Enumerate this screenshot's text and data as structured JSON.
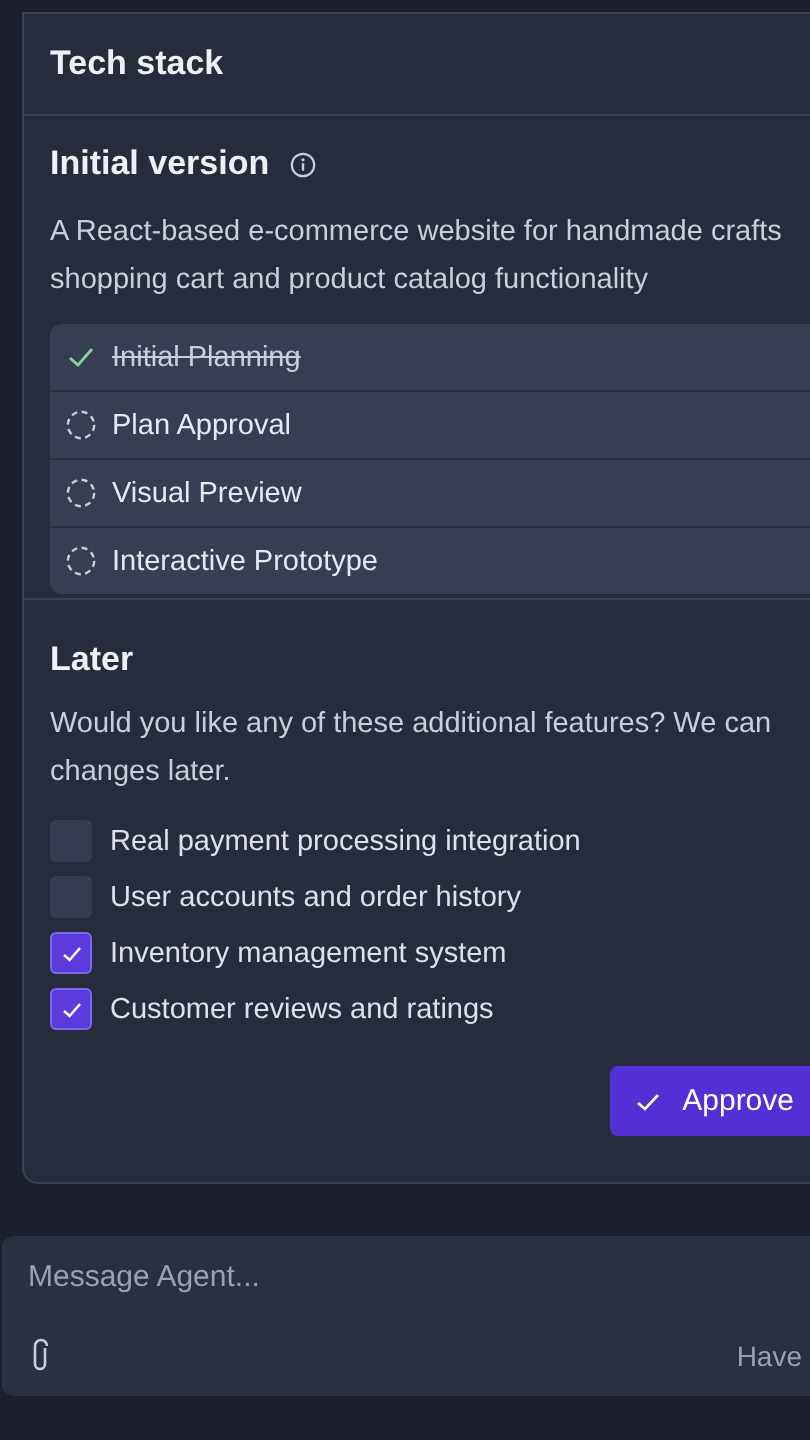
{
  "tech_stack": {
    "title": "Tech stack"
  },
  "initial_version": {
    "title": "Initial version",
    "description_lines": [
      "A React-based e-commerce website for handmade crafts",
      "shopping cart and product catalog functionality"
    ],
    "steps": [
      {
        "label": "Initial Planning",
        "done": true
      },
      {
        "label": "Plan Approval",
        "done": false
      },
      {
        "label": "Visual Preview",
        "done": false
      },
      {
        "label": "Interactive Prototype",
        "done": false
      }
    ]
  },
  "later": {
    "title": "Later",
    "prompt_lines": [
      "Would you like any of these additional features? We can",
      "changes later."
    ],
    "features": [
      {
        "label": "Real payment processing integration",
        "checked": false
      },
      {
        "label": "User accounts and order history",
        "checked": false
      },
      {
        "label": "Inventory management system",
        "checked": true
      },
      {
        "label": "Customer reviews and ratings",
        "checked": true
      }
    ],
    "approve_button": "Approve"
  },
  "composer": {
    "placeholder": "Message Agent...",
    "hint": "Have"
  }
}
